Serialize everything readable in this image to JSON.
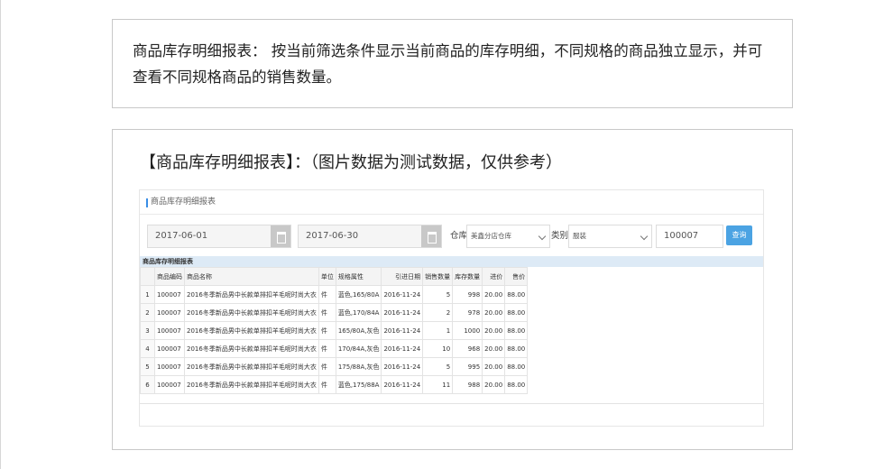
{
  "description": "商品库存明细报表： 按当前筛选条件显示当前商品的库存明细，不同规格的商品独立显示，并可查看不同规格商品的销售数量。",
  "heading": "【商品库存明细报表】：（图片数据为测试数据，仅供参考）",
  "app": {
    "title": "商品库存明细报表",
    "filter": {
      "date_from": "2017-06-01",
      "date_to": "2017-06-30",
      "warehouse_label": "仓库",
      "warehouse_value": "美鑫分店仓库",
      "category_label": "类别",
      "category_value": "服装",
      "code_value": "100007",
      "query_label": "查询"
    },
    "table": {
      "caption": "商品库存明细报表",
      "columns": [
        "",
        "商品编码",
        "商品名称",
        "单位",
        "规格属性",
        "引进日期",
        "销售数量",
        "库存数量",
        "进价",
        "售价"
      ],
      "rows": [
        [
          "1",
          "100007",
          "2016冬季新品男中长款单排扣羊毛呢时尚大衣",
          "件",
          "蓝色,165/80A",
          "2016-11-24",
          "5",
          "998",
          "20.00",
          "88.00"
        ],
        [
          "2",
          "100007",
          "2016冬季新品男中长款单排扣羊毛呢时尚大衣",
          "件",
          "蓝色,170/84A",
          "2016-11-24",
          "2",
          "978",
          "20.00",
          "88.00"
        ],
        [
          "3",
          "100007",
          "2016冬季新品男中长款单排扣羊毛呢时尚大衣",
          "件",
          "165/80A,灰色",
          "2016-11-24",
          "1",
          "1000",
          "20.00",
          "88.00"
        ],
        [
          "4",
          "100007",
          "2016冬季新品男中长款单排扣羊毛呢时尚大衣",
          "件",
          "170/84A,灰色",
          "2016-11-24",
          "10",
          "968",
          "20.00",
          "88.00"
        ],
        [
          "5",
          "100007",
          "2016冬季新品男中长款单排扣羊毛呢时尚大衣",
          "件",
          "175/88A,灰色",
          "2016-11-24",
          "5",
          "995",
          "20.00",
          "88.00"
        ],
        [
          "6",
          "100007",
          "2016冬季新品男中长款单排扣羊毛呢时尚大衣",
          "件",
          "蓝色,175/88A",
          "2016-11-24",
          "11",
          "988",
          "20.00",
          "88.00"
        ]
      ]
    }
  },
  "colors": {
    "accent": "#4ba3e3",
    "header_band": "#ddeaf6"
  }
}
